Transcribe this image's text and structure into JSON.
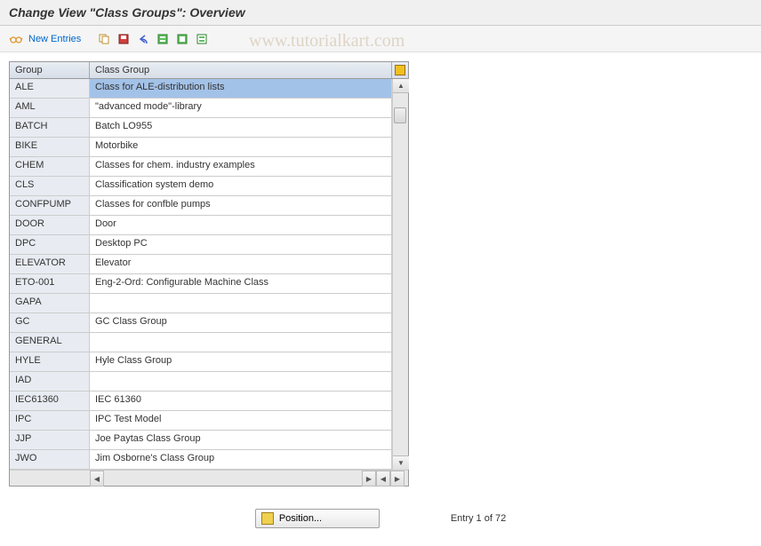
{
  "title": "Change View \"Class Groups\": Overview",
  "watermark": "www.tutorialkart.com",
  "toolbar": {
    "new_entries": "New Entries"
  },
  "table": {
    "header_group": "Group",
    "header_desc": "Class Group",
    "rows": [
      {
        "group": "ALE",
        "desc": "Class for ALE-distribution lists",
        "selected": true
      },
      {
        "group": "AML",
        "desc": "\"advanced mode\"-library"
      },
      {
        "group": "BATCH",
        "desc": "Batch LO955"
      },
      {
        "group": "BIKE",
        "desc": "Motorbike"
      },
      {
        "group": "CHEM",
        "desc": "Classes for chem. industry examples"
      },
      {
        "group": "CLS",
        "desc": "Classification system demo"
      },
      {
        "group": "CONFPUMP",
        "desc": "Classes for confble pumps"
      },
      {
        "group": "DOOR",
        "desc": "Door"
      },
      {
        "group": "DPC",
        "desc": "Desktop PC"
      },
      {
        "group": "ELEVATOR",
        "desc": "Elevator"
      },
      {
        "group": "ETO-001",
        "desc": "Eng-2-Ord: Configurable Machine Class"
      },
      {
        "group": "GAPA",
        "desc": ""
      },
      {
        "group": "GC",
        "desc": "GC Class Group"
      },
      {
        "group": "GENERAL",
        "desc": ""
      },
      {
        "group": "HYLE",
        "desc": "Hyle Class Group"
      },
      {
        "group": "IAD",
        "desc": ""
      },
      {
        "group": "IEC61360",
        "desc": "IEC 61360"
      },
      {
        "group": "IPC",
        "desc": "IPC Test Model"
      },
      {
        "group": "JJP",
        "desc": "Joe Paytas Class Group"
      },
      {
        "group": "JWO",
        "desc": "Jim Osborne's Class Group"
      }
    ]
  },
  "footer": {
    "position_label": "Position...",
    "entry_text": "Entry 1 of 72"
  }
}
